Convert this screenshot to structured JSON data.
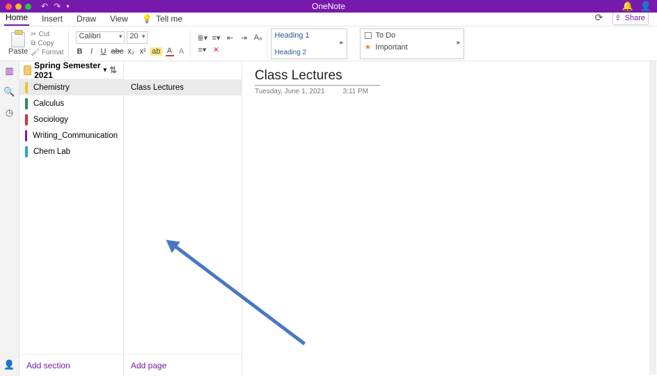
{
  "app": {
    "title": "OneNote"
  },
  "menu": {
    "tabs": [
      "Home",
      "Insert",
      "Draw",
      "View"
    ],
    "tellme": "Tell me",
    "share": "Share"
  },
  "ribbon": {
    "paste": "Paste",
    "cut": "Cut",
    "copy": "Copy",
    "format": "Format",
    "font": "Calibri",
    "size": "20",
    "heading1": "Heading 1",
    "heading2": "Heading 2",
    "todo": "To Do",
    "important": "Important"
  },
  "notebook": {
    "name": "Spring Semester 2021"
  },
  "sections": [
    {
      "label": "Chemistry",
      "color": "#f1c232",
      "selected": true
    },
    {
      "label": "Calculus",
      "color": "#2e8b57"
    },
    {
      "label": "Sociology",
      "color": "#d13438"
    },
    {
      "label": "Writing_Communication",
      "color": "#7719AA"
    },
    {
      "label": "Chem Lab",
      "color": "#2aa7c7"
    }
  ],
  "add_section": "Add section",
  "pages": [
    {
      "label": "Class Lectures",
      "selected": true
    }
  ],
  "add_page": "Add page",
  "page": {
    "title": "Class Lectures",
    "date": "Tuesday, June 1, 2021",
    "time": "3:11 PM"
  }
}
